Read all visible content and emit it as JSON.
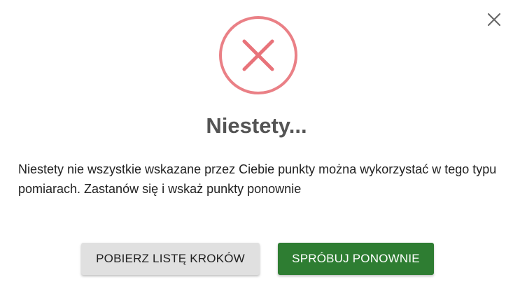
{
  "dialog": {
    "title": "Niestety...",
    "message": "Niestety nie wszystkie wskazane przez Ciebie punkty można wykorzystać w tego typu pomiarach. Zastanów się i wskaż punkty ponownie",
    "icon": "error-x-circle-icon",
    "close_icon": "close-icon",
    "error_color": "#e57373"
  },
  "buttons": {
    "download_steps_label": "POBIERZ LISTĘ KROKÓW",
    "retry_label": "SPRÓBUJ PONOWNIE",
    "retry_color": "#2e7d32",
    "secondary_color": "#e0e0e0"
  }
}
